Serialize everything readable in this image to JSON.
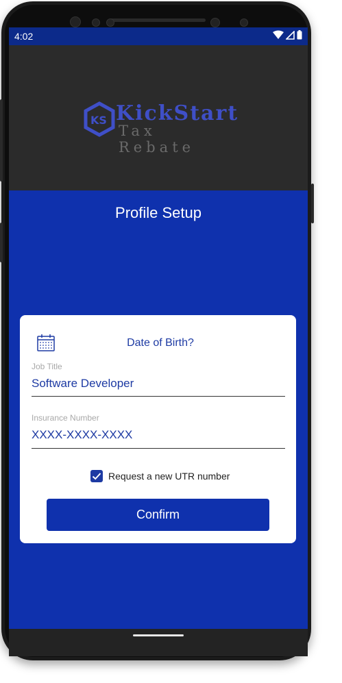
{
  "status_bar": {
    "time": "4:02",
    "icons": [
      "wifi-icon",
      "cell-signal-icon",
      "battery-icon"
    ]
  },
  "header": {
    "logo": {
      "monogram": "KS",
      "brand": "KickStart",
      "tagline": "Tax Rebate"
    }
  },
  "page": {
    "title": "Profile Setup"
  },
  "form": {
    "dob_label": "Date of Birth?",
    "job_title": {
      "label": "Job Title",
      "value": "Software Developer"
    },
    "insurance_number": {
      "label": "Insurance Number",
      "value": "XXXX-XXXX-XXXX"
    },
    "utr_checkbox": {
      "label": "Request a new UTR number",
      "checked": true
    },
    "confirm_label": "Confirm"
  },
  "colors": {
    "primary": "#0f31ad",
    "status_bar": "#0c2a8a",
    "header_bg": "#2b2b2b",
    "accent_text": "#1d3aa3",
    "card_bg": "#ffffff"
  }
}
